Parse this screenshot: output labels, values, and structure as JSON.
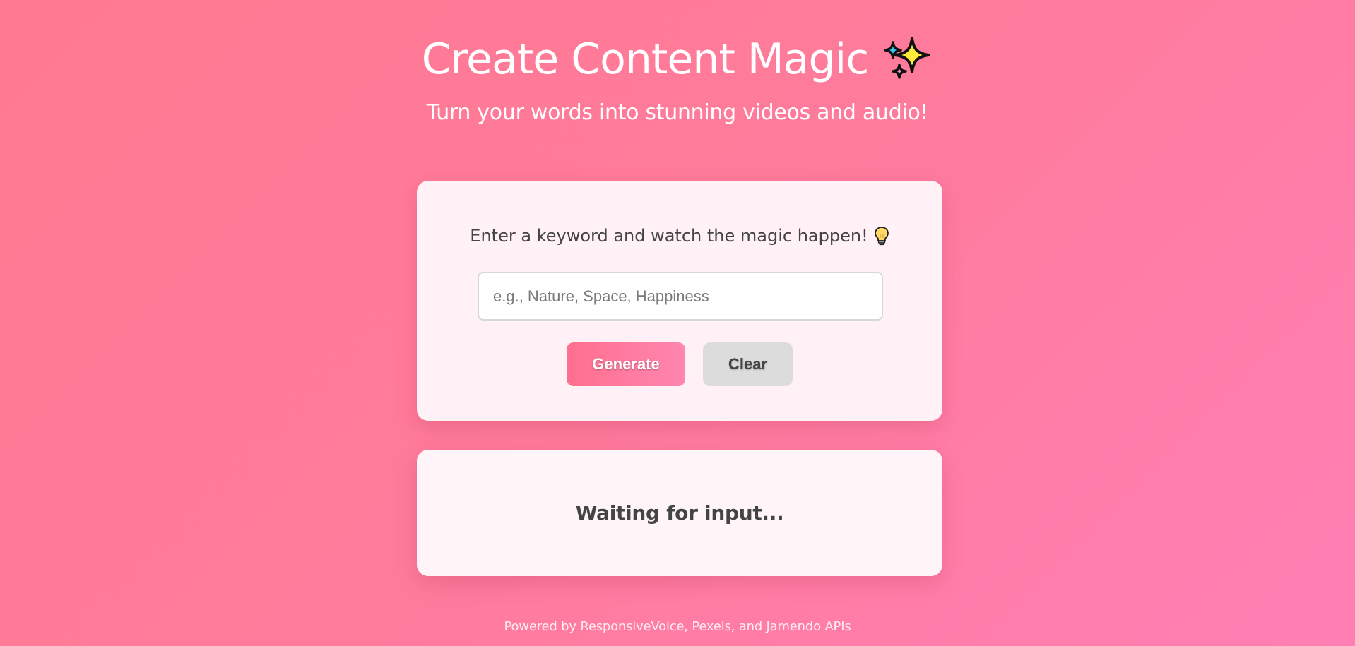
{
  "header": {
    "title": "Create Content Magic",
    "title_icon": "sparkles-icon",
    "subtitle": "Turn your words into stunning videos and audio!"
  },
  "input_card": {
    "prompt": "Enter a keyword and watch the magic happen!",
    "prompt_icon": "light-bulb-icon",
    "keyword_input": {
      "placeholder": "e.g., Nature, Space, Happiness",
      "value": ""
    },
    "generate_label": "Generate",
    "clear_label": "Clear"
  },
  "status_card": {
    "status": "Waiting for input..."
  },
  "footer": {
    "text": "Powered by ResponsiveVoice, Pexels, and Jamendo APIs"
  },
  "colors": {
    "background_start": "#ff7a90",
    "background_end": "#ff7fb4",
    "generate_button": "#ff6f8e",
    "clear_button": "#dcdcdc",
    "text_dark": "#444444"
  }
}
